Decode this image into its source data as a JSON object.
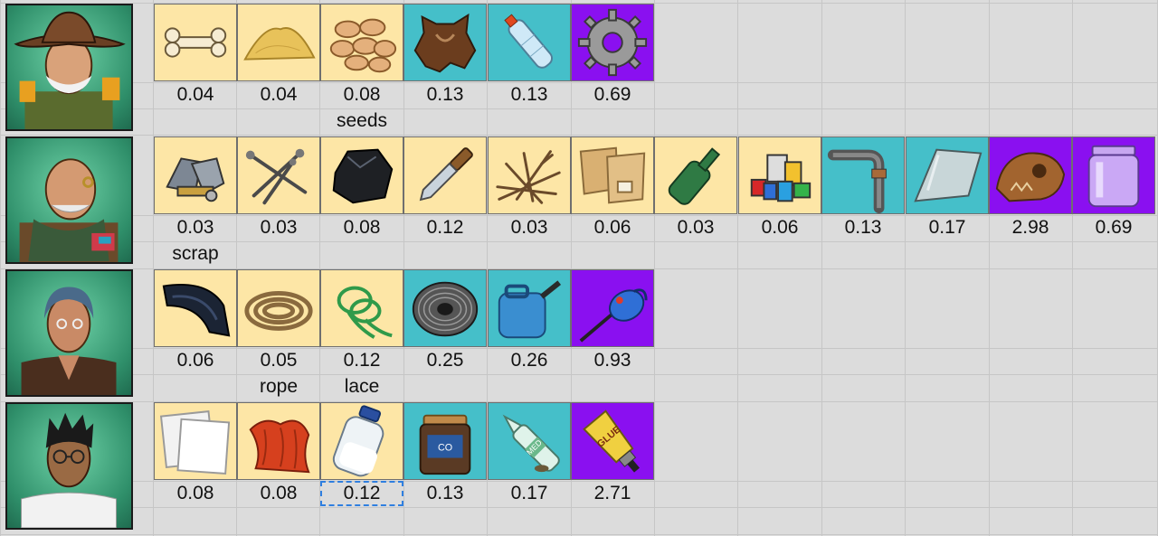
{
  "colors": {
    "common": "#fde6a6",
    "uncommon": "#45bfc9",
    "rare": "#8a10f0"
  },
  "rows": [
    {
      "character": "cowboy-hat-survivor-portrait",
      "items": [
        {
          "icon": "bone-icon",
          "rarity": "common",
          "value": "0.04",
          "label": ""
        },
        {
          "icon": "sand-pile-icon",
          "rarity": "common",
          "value": "0.04",
          "label": ""
        },
        {
          "icon": "seeds-icon",
          "rarity": "common",
          "value": "0.08",
          "label": "seeds"
        },
        {
          "icon": "animal-hide-icon",
          "rarity": "uncommon",
          "value": "0.13",
          "label": ""
        },
        {
          "icon": "plastic-bottle-icon",
          "rarity": "uncommon",
          "value": "0.13",
          "label": ""
        },
        {
          "icon": "gear-icon",
          "rarity": "rare",
          "value": "0.69",
          "label": ""
        }
      ]
    },
    {
      "character": "bald-mechanic-portrait",
      "items": [
        {
          "icon": "scrap-metal-icon",
          "rarity": "common",
          "value": "0.03",
          "label": "scrap"
        },
        {
          "icon": "nails-icon",
          "rarity": "common",
          "value": "0.03",
          "label": ""
        },
        {
          "icon": "coal-icon",
          "rarity": "common",
          "value": "0.08",
          "label": ""
        },
        {
          "icon": "knife-icon",
          "rarity": "common",
          "value": "0.12",
          "label": ""
        },
        {
          "icon": "twigs-icon",
          "rarity": "common",
          "value": "0.03",
          "label": ""
        },
        {
          "icon": "paper-scraps-icon",
          "rarity": "common",
          "value": "0.06",
          "label": ""
        },
        {
          "icon": "glass-bottle-icon",
          "rarity": "common",
          "value": "0.03",
          "label": ""
        },
        {
          "icon": "plastic-waste-icon",
          "rarity": "common",
          "value": "0.06",
          "label": ""
        },
        {
          "icon": "pipe-icon",
          "rarity": "uncommon",
          "value": "0.13",
          "label": ""
        },
        {
          "icon": "glass-shard-icon",
          "rarity": "uncommon",
          "value": "0.17",
          "label": ""
        },
        {
          "icon": "skull-fossil-icon",
          "rarity": "rare",
          "value": "2.98",
          "label": ""
        },
        {
          "icon": "glass-jar-icon",
          "rarity": "rare",
          "value": "0.69",
          "label": ""
        }
      ]
    },
    {
      "character": "blue-haired-woman-portrait",
      "items": [
        {
          "icon": "rubber-tire-piece-icon",
          "rarity": "common",
          "value": "0.06",
          "label": ""
        },
        {
          "icon": "rope-coil-icon",
          "rarity": "common",
          "value": "0.05",
          "label": "rope"
        },
        {
          "icon": "shoelace-icon",
          "rarity": "common",
          "value": "0.12",
          "label": "lace"
        },
        {
          "icon": "wire-spool-icon",
          "rarity": "uncommon",
          "value": "0.25",
          "label": ""
        },
        {
          "icon": "jerrycan-icon",
          "rarity": "uncommon",
          "value": "0.26",
          "label": ""
        },
        {
          "icon": "oil-can-icon",
          "rarity": "rare",
          "value": "0.93",
          "label": ""
        }
      ]
    },
    {
      "character": "scientist-with-glasses-portrait",
      "items": [
        {
          "icon": "paper-sheets-icon",
          "rarity": "common",
          "value": "0.08",
          "label": ""
        },
        {
          "icon": "red-cloth-icon",
          "rarity": "common",
          "value": "0.08",
          "label": ""
        },
        {
          "icon": "milk-bottle-icon",
          "rarity": "common",
          "value": "0.12",
          "label": "",
          "selected": true
        },
        {
          "icon": "coffee-jar-icon",
          "rarity": "uncommon",
          "value": "0.13",
          "label": ""
        },
        {
          "icon": "med-ampoule-icon",
          "rarity": "uncommon",
          "value": "0.17",
          "label": ""
        },
        {
          "icon": "glue-tube-icon",
          "rarity": "rare",
          "value": "2.71",
          "label": ""
        }
      ]
    }
  ],
  "glue_text": "GLUE",
  "med_text": "MED",
  "coffee_text": "CO"
}
